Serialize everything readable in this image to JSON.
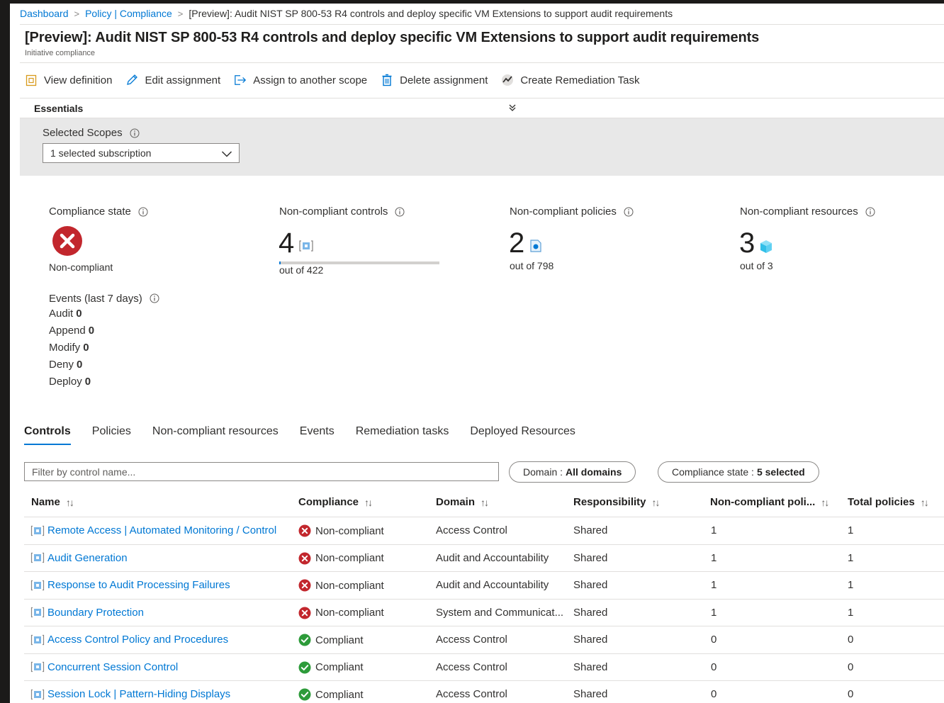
{
  "breadcrumb": {
    "items": [
      "Dashboard",
      "Policy | Compliance"
    ],
    "current": "[Preview]: Audit NIST SP 800-53 R4 controls and deploy specific VM Extensions to support audit requirements"
  },
  "header": {
    "title": "[Preview]: Audit NIST SP 800-53 R4 controls and deploy specific VM Extensions to support audit requirements",
    "subtitle": "Initiative compliance"
  },
  "toolbar": {
    "view_definition": "View definition",
    "edit_assignment": "Edit assignment",
    "assign_scope": "Assign to another scope",
    "delete_assignment": "Delete assignment",
    "create_remediation": "Create Remediation Task"
  },
  "essentials": {
    "label": "Essentials"
  },
  "scopes": {
    "label": "Selected Scopes",
    "value": "1 selected subscription"
  },
  "summary": {
    "compliance_state": {
      "label": "Compliance state",
      "value": "Non-compliant"
    },
    "controls": {
      "label": "Non-compliant controls",
      "count": "4",
      "total": "out of 422",
      "fraction": 0.0095
    },
    "policies": {
      "label": "Non-compliant policies",
      "count": "2",
      "total": "out of 798"
    },
    "resources": {
      "label": "Non-compliant resources",
      "count": "3",
      "total": "out of 3"
    }
  },
  "events": {
    "label": "Events (last 7 days)",
    "items": [
      {
        "name": "Audit",
        "count": "0"
      },
      {
        "name": "Append",
        "count": "0"
      },
      {
        "name": "Modify",
        "count": "0"
      },
      {
        "name": "Deny",
        "count": "0"
      },
      {
        "name": "Deploy",
        "count": "0"
      }
    ]
  },
  "tabs": [
    "Controls",
    "Policies",
    "Non-compliant resources",
    "Events",
    "Remediation tasks",
    "Deployed Resources"
  ],
  "filter": {
    "placeholder": "Filter by control name..."
  },
  "pills": {
    "domain_label": "Domain :",
    "domain_value": "All domains",
    "state_label": "Compliance state :",
    "state_value": "5 selected"
  },
  "table": {
    "columns": [
      "Name",
      "Compliance",
      "Domain",
      "Responsibility",
      "Non-compliant poli...",
      "Total policies"
    ],
    "rows": [
      {
        "name": "Remote Access | Automated Monitoring / Control",
        "compliance": "Non-compliant",
        "domain": "Access Control",
        "responsibility": "Shared",
        "noncompliant": "1",
        "total": "1"
      },
      {
        "name": "Audit Generation",
        "compliance": "Non-compliant",
        "domain": "Audit and Accountability",
        "responsibility": "Shared",
        "noncompliant": "1",
        "total": "1"
      },
      {
        "name": "Response to Audit Processing Failures",
        "compliance": "Non-compliant",
        "domain": "Audit and Accountability",
        "responsibility": "Shared",
        "noncompliant": "1",
        "total": "1"
      },
      {
        "name": "Boundary Protection",
        "compliance": "Non-compliant",
        "domain": "System and Communicat...",
        "responsibility": "Shared",
        "noncompliant": "1",
        "total": "1"
      },
      {
        "name": "Access Control Policy and Procedures",
        "compliance": "Compliant",
        "domain": "Access Control",
        "responsibility": "Shared",
        "noncompliant": "0",
        "total": "0"
      },
      {
        "name": "Concurrent Session Control",
        "compliance": "Compliant",
        "domain": "Access Control",
        "responsibility": "Shared",
        "noncompliant": "0",
        "total": "0"
      },
      {
        "name": "Session Lock | Pattern-Hiding Displays",
        "compliance": "Compliant",
        "domain": "Access Control",
        "responsibility": "Shared",
        "noncompliant": "0",
        "total": "0"
      }
    ]
  },
  "colors": {
    "accent": "#0078d4",
    "error": "#a4262c",
    "success": "#107c10",
    "panel": "#e8e8e8"
  }
}
